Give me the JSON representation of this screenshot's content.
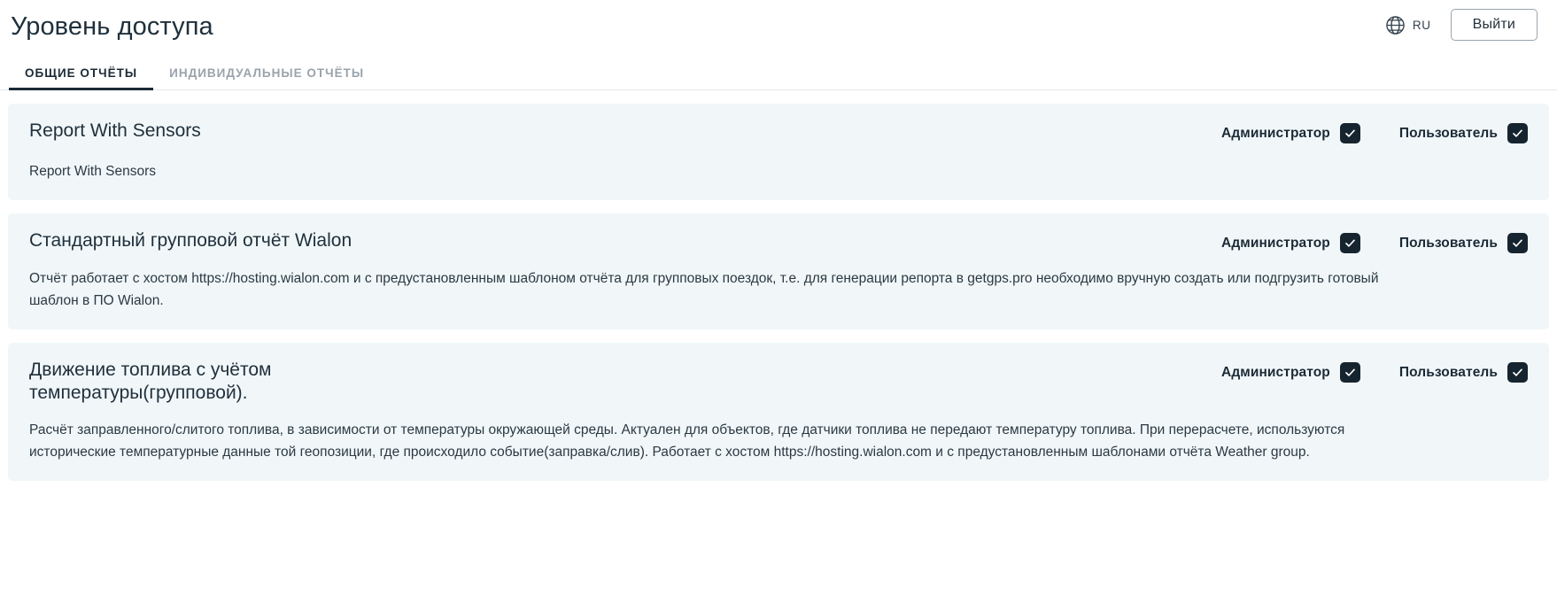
{
  "header": {
    "title": "Уровень доступа",
    "language": {
      "icon": "globe-icon",
      "code": "RU"
    },
    "logout_label": "Выйти"
  },
  "tabs": [
    {
      "label": "ОБЩИЕ ОТЧЁТЫ",
      "active": true
    },
    {
      "label": "ИНДИВИДУАЛЬНЫЕ ОТЧЁТЫ",
      "active": false
    }
  ],
  "roles": {
    "admin_label": "Администратор",
    "user_label": "Пользователь"
  },
  "cards": [
    {
      "title": "Report With Sensors",
      "description": "Report With Sensors",
      "admin_checked": true,
      "user_checked": true
    },
    {
      "title": "Стандартный групповой отчёт Wialon",
      "description": "Отчёт работает с хостом https://hosting.wialon.com и с предустановленным шаблоном отчёта для групповых поездок, т.е. для генерации репорта в getgps.pro необходимо вручную создать или подгрузить готовый шаблон в ПО Wialon.",
      "admin_checked": true,
      "user_checked": true
    },
    {
      "title": "Движение топлива с учётом температуры(групповой).",
      "description": "Расчёт заправленного/слитого топлива, в зависимости от температуры окружающей среды. Актуален для объектов, где датчики топлива не передают температуру топлива. При перерасчете, используются исторические температурные данные той геопозиции, где происходило событие(заправка/слив). Работает с хостом https://hosting.wialon.com и с предустановленным шаблонами отчёта Weather group.",
      "admin_checked": true,
      "user_checked": true
    }
  ],
  "colors": {
    "card_background": "#f1f7f9",
    "checkbox_fill": "#16242f",
    "accent": "#1b2a36"
  }
}
